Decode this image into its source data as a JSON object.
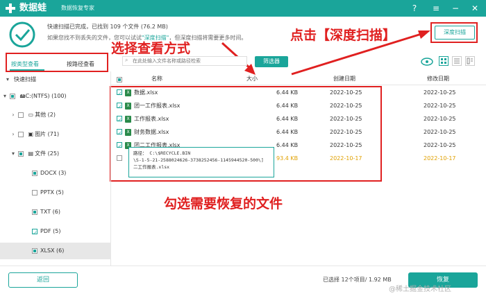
{
  "app": {
    "title": "数据蛙",
    "subtitle": "数据恢复专家"
  },
  "titlebar": {
    "help_icon": "?",
    "menu_icon": "≡",
    "minimize_icon": "−",
    "close_icon": "✕"
  },
  "header": {
    "status_line1": "快速扫描已完成，已找到 109 个文件 (76.2 MB)",
    "status_line2_a": "如果您找不到丢失的文件，您可以试试",
    "status_line2_link": "\"深度扫描\"",
    "status_line2_b": "，但深度扫描将需要更多时间。",
    "deep_scan_label": "深度扫描"
  },
  "annotations": {
    "choose_view": "选择查看方式",
    "click_deep": "点击【深度扫描】",
    "check_files": "勾选需要恢复的文件"
  },
  "view_tabs": {
    "by_type": "按类型查看",
    "by_path": "按路径查看"
  },
  "search": {
    "placeholder": "在此处输入文件名称或路径检索"
  },
  "filter_label": "筛选器",
  "sidebar": {
    "quick_scan": "快速扫描",
    "items": [
      {
        "label": "C:(NTFS) (100)"
      },
      {
        "label": "其他 (2)"
      },
      {
        "label": "图片 (71)"
      },
      {
        "label": "文件 (25)"
      },
      {
        "label": "DOCX (3)"
      },
      {
        "label": "PPTX (5)"
      },
      {
        "label": "TXT (6)"
      },
      {
        "label": "PDF (5)"
      },
      {
        "label": "XLSX (6)"
      }
    ]
  },
  "table": {
    "headers": {
      "name": "名称",
      "size": "大小",
      "created": "创建日期",
      "modified": "修改日期"
    },
    "rows": [
      {
        "name": "数据.xlsx",
        "size": "6.44 KB",
        "created": "2022-10-25",
        "modified": "2022-10-25"
      },
      {
        "name": "团一工作报表.xlsx",
        "size": "6.44 KB",
        "created": "2022-10-25",
        "modified": "2022-10-25"
      },
      {
        "name": "工作报表.xlsx",
        "size": "6.44 KB",
        "created": "2022-10-25",
        "modified": "2022-10-25"
      },
      {
        "name": "财务数据.xlsx",
        "size": "6.44 KB",
        "created": "2022-10-25",
        "modified": "2022-10-25"
      },
      {
        "name": "团二工作报表.xlsx",
        "size": "6.44 KB",
        "created": "2022-10-25",
        "modified": "2022-10-25"
      },
      {
        "name": "",
        "size": "93.4 KB",
        "created": "2022-10-17",
        "modified": "2022-10-17"
      }
    ]
  },
  "tooltip": {
    "line1": "路径： C:\\$RECYCLE.BIN",
    "line2": "\\S-1-5-21-2588024626-3738252456-1145944520-500\\]",
    "line3": "二工作报表.xlsx"
  },
  "footer": {
    "back_label": "返回",
    "summary": "已选择 12个项目/ 1.92 MB",
    "recover_label": "恢复",
    "watermark": "@稀土掘金技术社区"
  }
}
